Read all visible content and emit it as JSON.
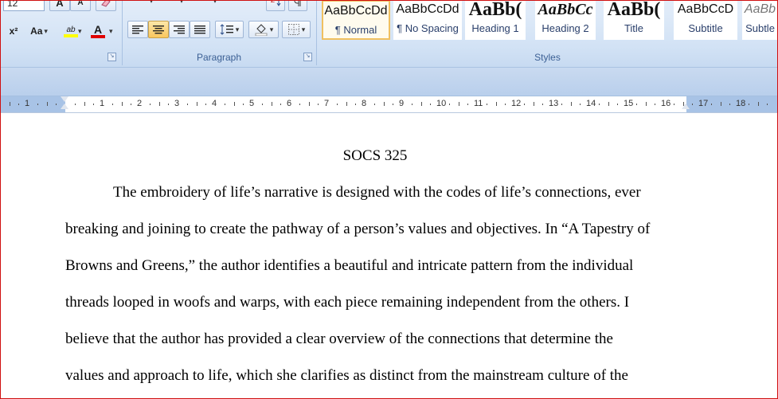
{
  "font_group": {
    "font_size": "12",
    "grow_font": "A",
    "shrink_font": "A",
    "superscript": "x²",
    "change_case": "Aa",
    "highlight": "ab",
    "font_color": "A"
  },
  "paragraph_group": {
    "label": "Paragraph"
  },
  "styles_group": {
    "label": "Styles",
    "items": [
      {
        "sample": "AaBbCcDd",
        "name": "¶ Normal"
      },
      {
        "sample": "AaBbCcDd",
        "name": "¶ No Spacing"
      },
      {
        "sample": "AaBb(",
        "name": "Heading 1"
      },
      {
        "sample": "AaBbCc",
        "name": "Heading 2"
      },
      {
        "sample": "AaBb(",
        "name": "Title"
      },
      {
        "sample": "AaBbCcD",
        "name": "Subtitle"
      },
      {
        "sample": "AaBb",
        "name": "Subtle"
      }
    ]
  },
  "ruler": {
    "numbers": [
      "1",
      "1",
      "2",
      "3",
      "4",
      "5",
      "6",
      "7",
      "8",
      "9",
      "10",
      "11",
      "12",
      "13",
      "14",
      "15",
      "16",
      "17",
      "18"
    ]
  },
  "document": {
    "title": "SOCS 325",
    "lines": [
      "The embroidery of life’s narrative is designed with the codes of life’s connections, ever",
      "breaking and joining to create the pathway of a person’s values and objectives. In “A Tapestry of",
      "Browns and Greens,” the author identifies a beautiful and intricate pattern from the individual",
      "threads looped in woofs and warps, with each piece remaining independent from the others. I",
      "believe that the author has provided a clear overview of the connections that determine the",
      "values and approach to life, which she clarifies as distinct from the mainstream culture of the"
    ]
  },
  "colors": {
    "highlight": "#ffff00",
    "font_color": "#e00000",
    "ribbon": "#d2e2f5",
    "border": "#d01010"
  }
}
